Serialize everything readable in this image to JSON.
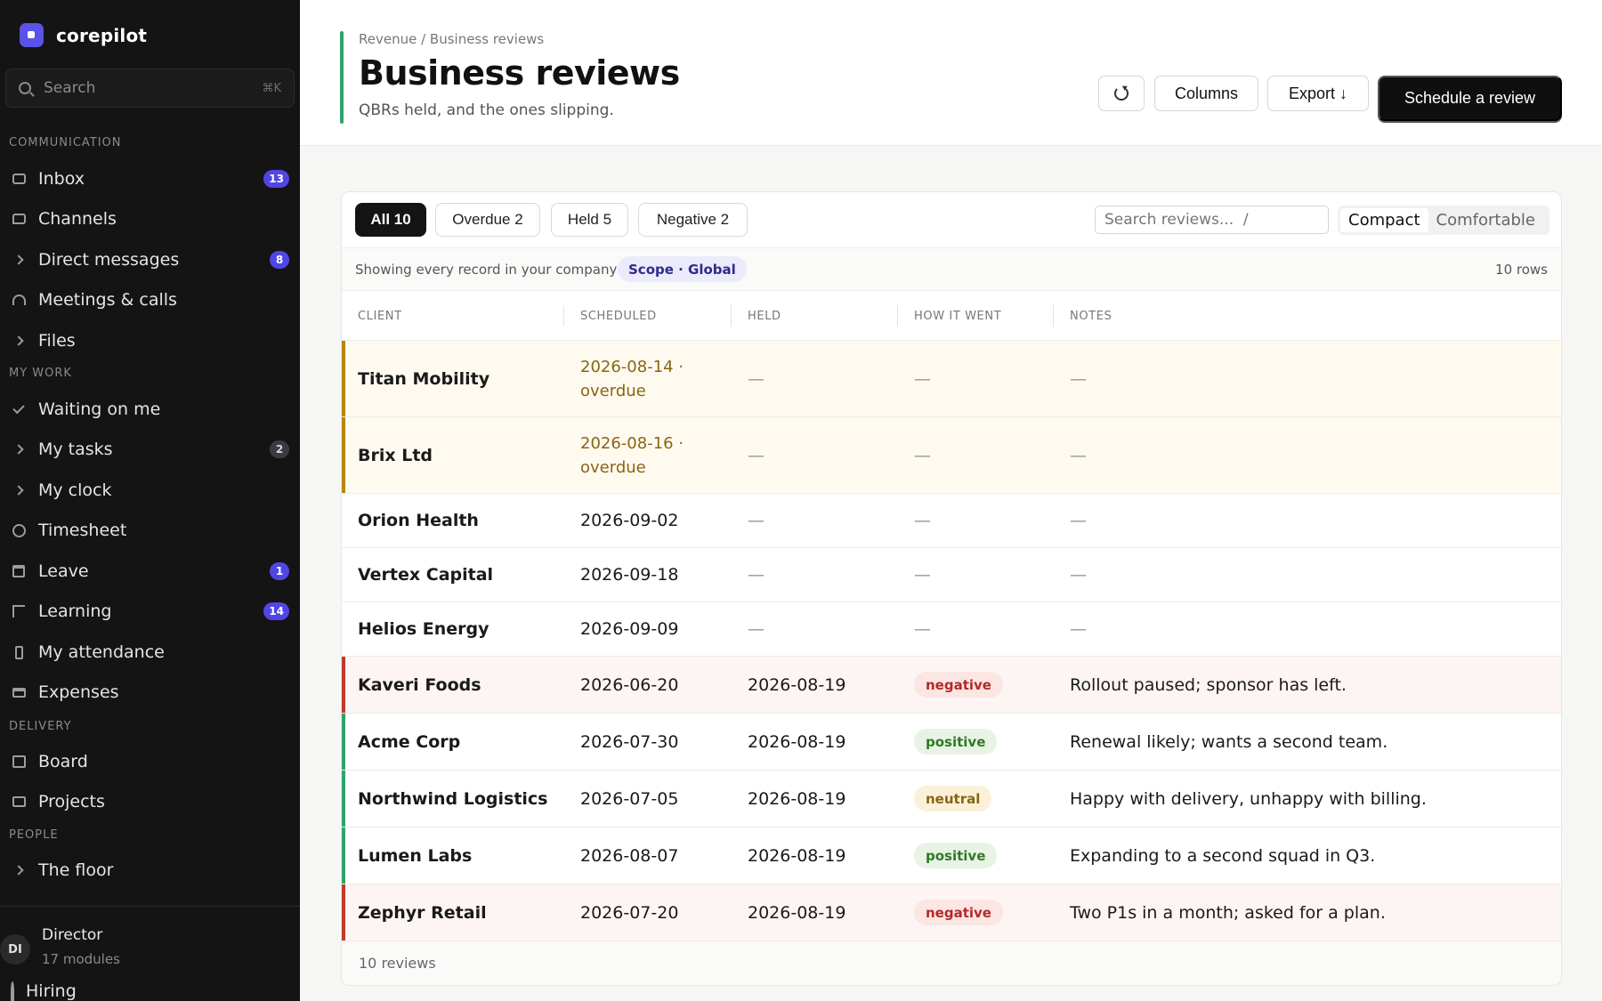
{
  "app": {
    "name": "corepilot"
  },
  "search": {
    "placeholder": "Search",
    "shortcut": "⌘K"
  },
  "sidebar": {
    "sections": [
      {
        "label": "COMMUNICATION"
      },
      {
        "label": "MY WORK"
      },
      {
        "label": "DELIVERY"
      },
      {
        "label": "PEOPLE"
      }
    ],
    "items": [
      {
        "label": "Inbox",
        "icon": "inbox-icon",
        "badge": "13"
      },
      {
        "label": "Channels",
        "icon": "chat-bubble-icon",
        "badge": ""
      },
      {
        "label": "Direct messages",
        "icon": "chevron-right-icon",
        "badge": "8"
      },
      {
        "label": "Meetings & calls",
        "icon": "headset-icon",
        "badge": ""
      },
      {
        "label": "Files",
        "icon": "chevron-right-icon",
        "badge": ""
      },
      {
        "label": "Waiting on me",
        "icon": "check-icon",
        "badge": ""
      },
      {
        "label": "My tasks",
        "icon": "chevron-right-icon",
        "badge": "2"
      },
      {
        "label": "My clock",
        "icon": "chevron-right-icon",
        "badge": ""
      },
      {
        "label": "Timesheet",
        "icon": "clock-icon",
        "badge": ""
      },
      {
        "label": "Leave",
        "icon": "calendar-icon",
        "badge": "1"
      },
      {
        "label": "Learning",
        "icon": "learning-icon",
        "badge": "14"
      },
      {
        "label": "My attendance",
        "icon": "phone-icon",
        "badge": ""
      },
      {
        "label": "Expenses",
        "icon": "card-icon",
        "badge": ""
      },
      {
        "label": "Board",
        "icon": "board-icon",
        "badge": ""
      },
      {
        "label": "Projects",
        "icon": "briefcase-icon",
        "badge": ""
      },
      {
        "label": "The floor",
        "icon": "chevron-right-icon",
        "badge": ""
      }
    ],
    "user": {
      "initials": "DI",
      "role": "Director",
      "modules": "17 modules"
    },
    "hiring_label": "Hiring"
  },
  "header": {
    "breadcrumb": "Revenue / Business reviews",
    "title": "Business reviews",
    "subtitle": "QBRs held, and the ones slipping.",
    "columns_label": "Columns",
    "export_label": "Export ↓",
    "primary_label": "Schedule a review"
  },
  "toolbar": {
    "filters": [
      {
        "label": "All 10"
      },
      {
        "label": "Overdue 2"
      },
      {
        "label": "Held 5"
      },
      {
        "label": "Negative 2"
      }
    ],
    "search_placeholder": "Search reviews...  /",
    "density": {
      "compact": "Compact",
      "comfortable": "Comfortable"
    }
  },
  "scope": {
    "text": "Showing every record in your company",
    "chip": "Scope · Global",
    "rows": "10 rows"
  },
  "table": {
    "columns": [
      "CLIENT",
      "SCHEDULED",
      "HELD",
      "HOW IT WENT",
      "NOTES"
    ],
    "rows": [
      {
        "client": "Titan Mobility",
        "scheduled": "2026-08-14 · overdue",
        "held": "—",
        "how": "—",
        "notes": "—"
      },
      {
        "client": "Brix Ltd",
        "scheduled": "2026-08-16 · overdue",
        "held": "—",
        "how": "—",
        "notes": "—"
      },
      {
        "client": "Orion Health",
        "scheduled": "2026-09-02",
        "held": "—",
        "how": "—",
        "notes": "—"
      },
      {
        "client": "Vertex Capital",
        "scheduled": "2026-09-18",
        "held": "—",
        "how": "—",
        "notes": "—"
      },
      {
        "client": "Helios Energy",
        "scheduled": "2026-09-09",
        "held": "—",
        "how": "—",
        "notes": "—"
      },
      {
        "client": "Kaveri Foods",
        "scheduled": "2026-06-20",
        "held": "2026-08-19",
        "how": "negative",
        "notes": "Rollout paused; sponsor has left."
      },
      {
        "client": "Acme Corp",
        "scheduled": "2026-07-30",
        "held": "2026-08-19",
        "how": "positive",
        "notes": "Renewal likely; wants a second team."
      },
      {
        "client": "Northwind Logistics",
        "scheduled": "2026-07-05",
        "held": "2026-08-19",
        "how": "neutral",
        "notes": "Happy with delivery, unhappy with billing."
      },
      {
        "client": "Lumen Labs",
        "scheduled": "2026-08-07",
        "held": "2026-08-19",
        "how": "positive",
        "notes": "Expanding to a second squad in Q3."
      },
      {
        "client": "Zephyr Retail",
        "scheduled": "2026-07-20",
        "held": "2026-08-19",
        "how": "negative",
        "notes": "Two P1s in a month; asked for a plan."
      }
    ],
    "footer": "10 reviews"
  },
  "colors": {
    "brand": "#5b52e8",
    "overdue_accent": "#b8860b",
    "negative_accent": "#c0392b",
    "positive_accent": "#2fa36b",
    "header_accent": "#2fa36b"
  }
}
